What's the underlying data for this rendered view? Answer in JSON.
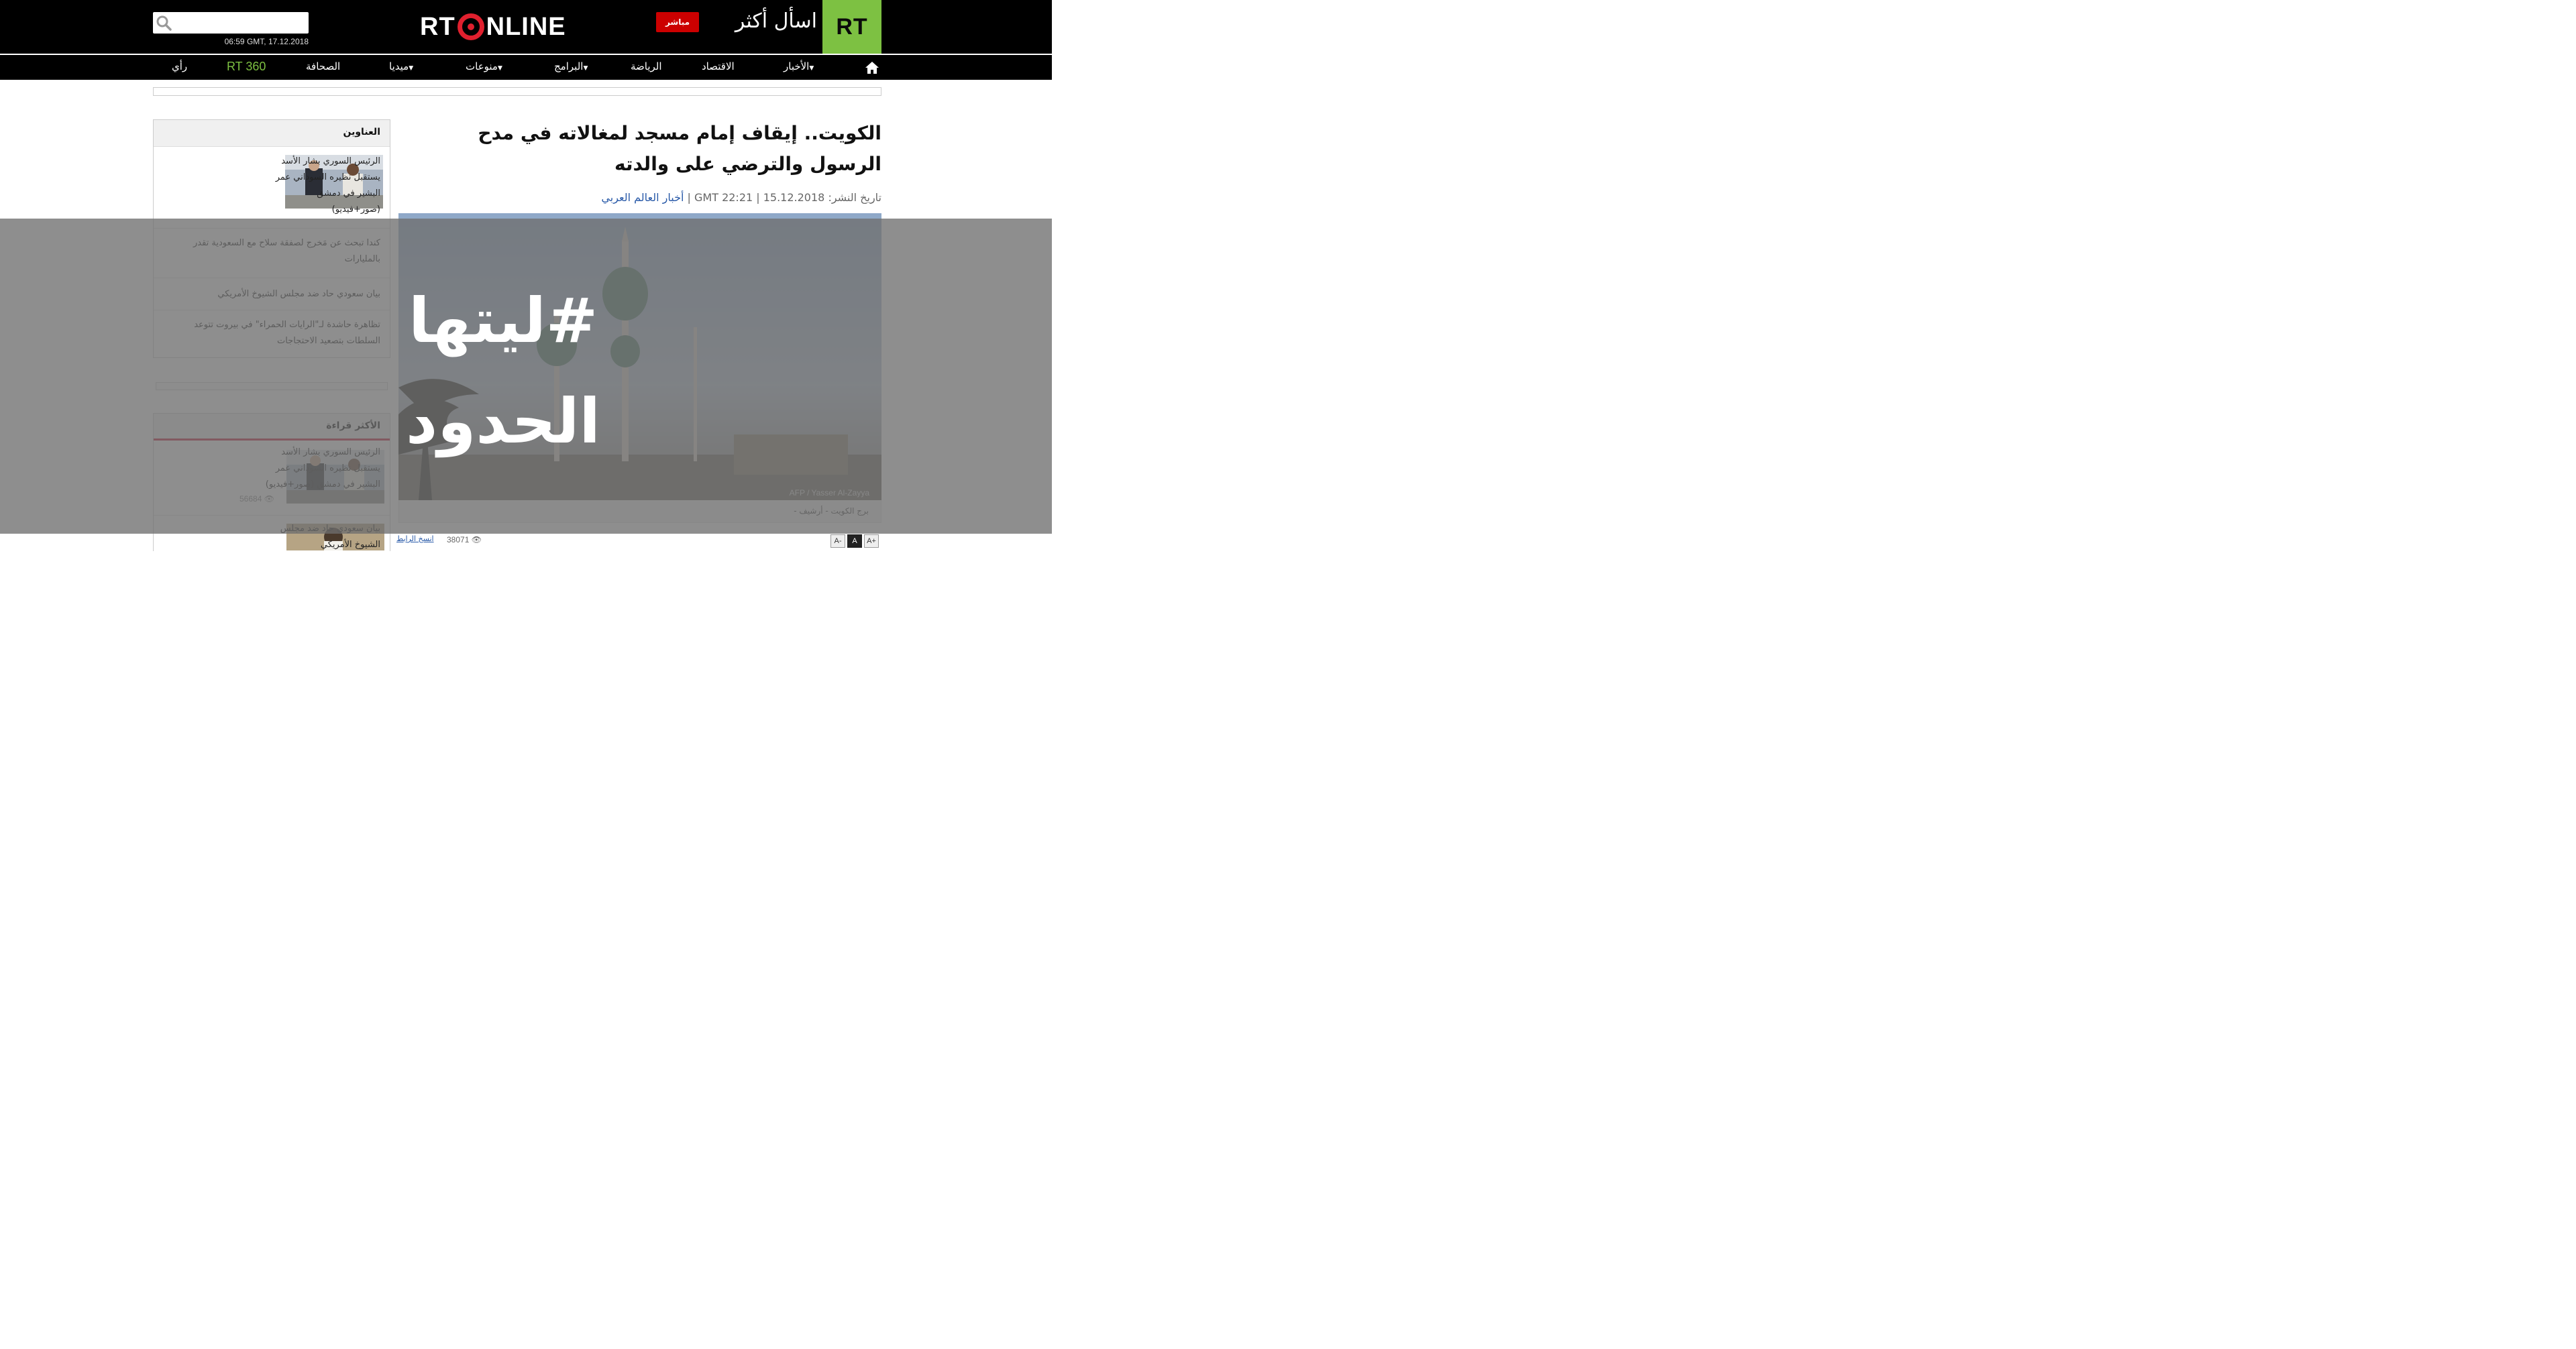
{
  "header": {
    "logo": "RT",
    "slogan": "اسأل أكثر",
    "live_label": "مباشر",
    "brand_left": "RT",
    "brand_right": "NLINE",
    "search_placeholder": "",
    "datetime": "06:59 GMT, 17.12.2018",
    "colors": {
      "logo_bg": "#7dc142",
      "live_bg": "#cc0000",
      "brand_ring": "#e0202e"
    }
  },
  "nav": {
    "home_icon": "home-icon",
    "items": [
      {
        "label": "الأخبار",
        "caret": true
      },
      {
        "label": "الاقتصاد",
        "caret": false
      },
      {
        "label": "الرياضة",
        "caret": false
      },
      {
        "label": "البرامج",
        "caret": true
      },
      {
        "label": "منوعات",
        "caret": true
      },
      {
        "label": "ميديا",
        "caret": true
      },
      {
        "label": "الصحافة",
        "caret": false
      },
      {
        "label": "RT 360",
        "caret": false
      },
      {
        "label": "رأي",
        "caret": false
      }
    ]
  },
  "article": {
    "title": "الكويت.. إيقاف إمام مسجد لمغالاته في مدح الرسول والترضي على والدته",
    "meta_prefix": "تاريخ النشر:",
    "date": "15.12.2018",
    "time": "GMT 22:21",
    "category": "أخبار العالم العربي",
    "photo_credit": "AFP / Yasser Al-Zayya",
    "caption": "برج الكويت - أرشيف -",
    "copy_link": "انسخ الرابط",
    "views": "38071",
    "font_buttons": [
      "A-",
      "A",
      "A+"
    ]
  },
  "sidebar": {
    "headlines_title": "العناوين",
    "headlines": [
      "الرئيس السوري بشار الأسد يستقبل نظيره السوداني عمر البشير في دمشق (صور+فيديو)",
      "كندا تبحث عن مَخرج لصفقة سلاح مع السعودية تقدر بالمليارات",
      "بيان سعودي حاد ضد مجلس الشيوخ الأمريكي",
      "تظاهرة حاشدة لـ\"الرايات الحمراء\" في بيروت تتوعد السلطات بتصعيد الاحتجاجات"
    ],
    "most_read_title": "الأكثر قراءة",
    "most_read": [
      {
        "text": "الرئيس السوري بشار الأسد يستقبل نظيره السوداني عمر البشير في دمشق (صور+فيديو)",
        "views": "56684"
      },
      {
        "text": "بيان سعودي حاد ضد مجلس الشيوخ الأمريكي",
        "views": ""
      }
    ]
  },
  "overlay": {
    "text": "#ليتها الحدود"
  }
}
